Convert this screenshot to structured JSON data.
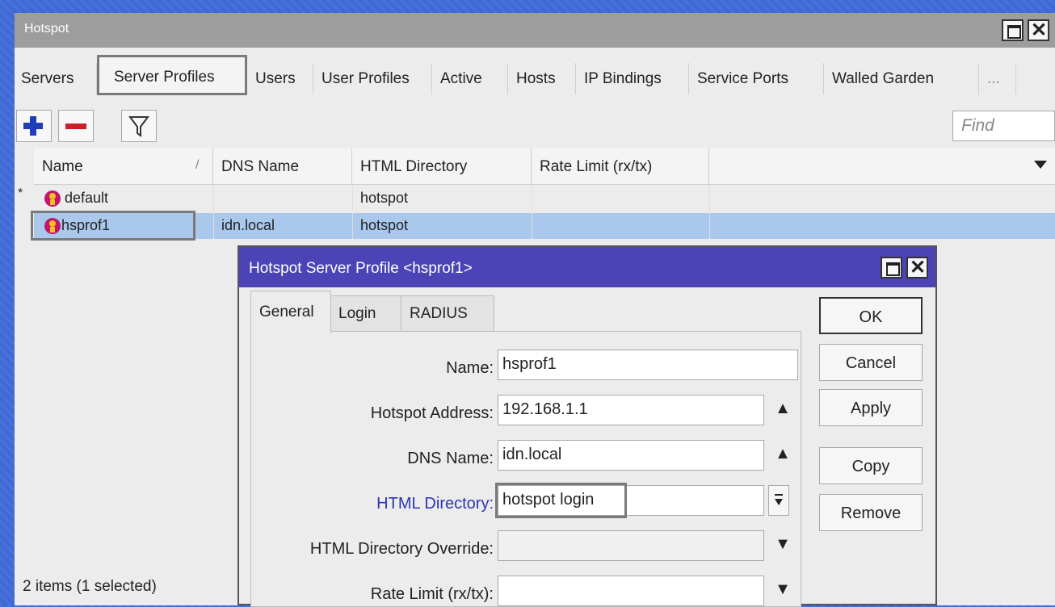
{
  "window": {
    "title": "Hotspot"
  },
  "tabs": [
    "Servers",
    "Server Profiles",
    "Users",
    "User Profiles",
    "Active",
    "Hosts",
    "IP Bindings",
    "Service Ports",
    "Walled Garden",
    "..."
  ],
  "toolbar": {
    "add": "+",
    "remove": "−",
    "find_placeholder": "Find"
  },
  "table": {
    "columns": [
      "Name",
      "DNS Name",
      "HTML Directory",
      "Rate Limit (rx/tx)"
    ],
    "sort_marker": "/",
    "rows": [
      {
        "marker": "*",
        "name": "default",
        "dns": "",
        "dir": "hotspot",
        "rate": ""
      },
      {
        "marker": "",
        "name": "hsprof1",
        "dns": "idn.local",
        "dir": "hotspot",
        "rate": ""
      }
    ]
  },
  "status": "2 items (1 selected)",
  "dialog": {
    "title": "Hotspot Server Profile <hsprof1>",
    "tabs": [
      "General",
      "Login",
      "RADIUS"
    ],
    "fields": {
      "name": {
        "label": "Name:",
        "value": "hsprof1"
      },
      "hotspot_address": {
        "label": "Hotspot Address:",
        "value": "192.168.1.1"
      },
      "dns_name": {
        "label": "DNS Name:",
        "value": "idn.local"
      },
      "html_directory": {
        "label": "HTML Directory:",
        "value": "hotspot login"
      },
      "html_directory_override": {
        "label": "HTML Directory Override:",
        "value": ""
      },
      "rate_limit": {
        "label": "Rate Limit (rx/tx):",
        "value": ""
      }
    },
    "buttons": [
      "OK",
      "Cancel",
      "Apply",
      "Copy",
      "Remove"
    ]
  },
  "colors": {
    "desktop": "#3f6ad6",
    "selected_row": "#a9c8ec",
    "dialog_title": "#4c44b6",
    "link_label": "#2b36b8"
  }
}
